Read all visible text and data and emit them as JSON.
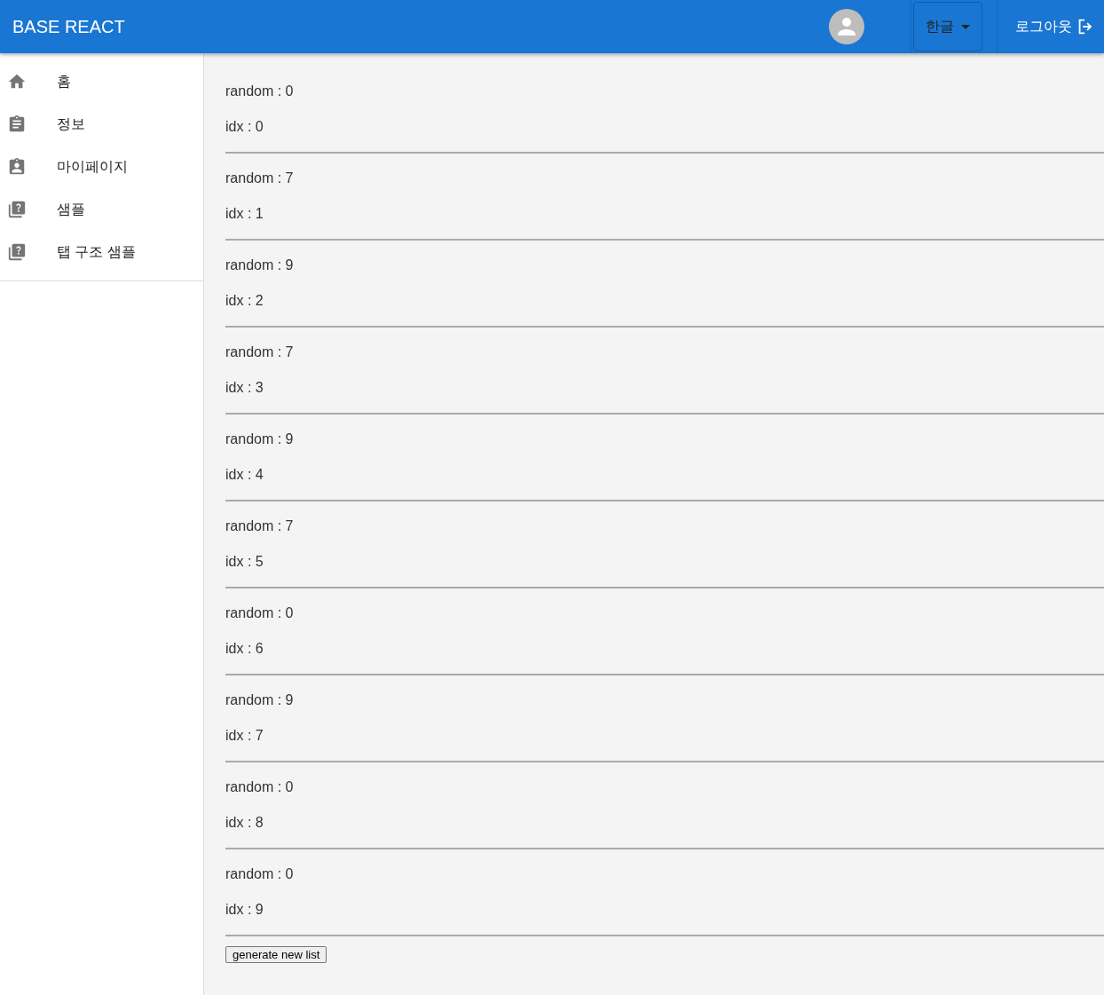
{
  "header": {
    "title": "BASE REACT",
    "language": "한글",
    "logout": "로그아웃"
  },
  "sidebar": {
    "items": [
      {
        "kind": "home",
        "label": "홈"
      },
      {
        "kind": "clipboard",
        "label": "정보"
      },
      {
        "kind": "badge",
        "label": "마이페이지"
      },
      {
        "kind": "help",
        "label": "샘플"
      },
      {
        "kind": "help",
        "label": "탭 구조 샘플"
      }
    ]
  },
  "list": [
    {
      "random": "random : 0",
      "idx": "idx : 0"
    },
    {
      "random": "random : 7",
      "idx": "idx : 1"
    },
    {
      "random": "random : 9",
      "idx": "idx : 2"
    },
    {
      "random": "random : 7",
      "idx": "idx : 3"
    },
    {
      "random": "random : 9",
      "idx": "idx : 4"
    },
    {
      "random": "random : 7",
      "idx": "idx : 5"
    },
    {
      "random": "random : 0",
      "idx": "idx : 6"
    },
    {
      "random": "random : 9",
      "idx": "idx : 7"
    },
    {
      "random": "random : 0",
      "idx": "idx : 8"
    },
    {
      "random": "random : 0",
      "idx": "idx : 9"
    }
  ],
  "button": "generate new list"
}
